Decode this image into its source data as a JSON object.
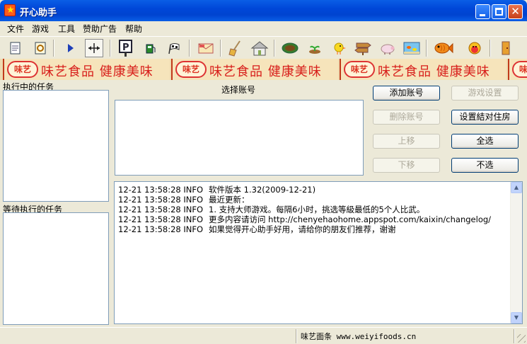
{
  "window": {
    "title": "开心助手",
    "icon": "app-star-icon"
  },
  "menu": [
    "文件",
    "游戏",
    "工具",
    "赞助广告",
    "帮助"
  ],
  "toolbar": {
    "icons": [
      "print-icon",
      "settings-icon",
      "play-icon",
      "resize-arrows-icon",
      "parking-icon",
      "fuel-icon",
      "race-flag-icon",
      "mail-icon",
      "broom-icon",
      "house-icon",
      "garden-icon",
      "sprout-icon",
      "chick-icon",
      "signpost-icon",
      "pig-icon",
      "aquarium-icon",
      "fish-icon",
      "friend-avatar-icon",
      "exit-door-icon"
    ]
  },
  "banner": {
    "logo": "味艺",
    "slogan": "味艺食品 健康美味"
  },
  "running_tasks": {
    "label": "执行中的任务"
  },
  "waiting_tasks": {
    "label": "等待执行的任务"
  },
  "accounts": {
    "label": "选择账号"
  },
  "buttons": {
    "add_account": "添加账号",
    "game_settings": "游戏设置",
    "delete_account": "删除账号",
    "set_house": "设置結对住房",
    "move_up": "上移",
    "select_all": "全选",
    "move_down": "下移",
    "select_none": "不选"
  },
  "log": [
    {
      "time": "12-21 13:58:28 INFO",
      "msg": "软件版本 1.32(2009-12-21)"
    },
    {
      "time": "12-21 13:58:28 INFO",
      "msg": "最近更新："
    },
    {
      "time": "12-21 13:58:28 INFO",
      "msg": "1. 支持大师游戏。每隔6小时，挑选等級最低的5个人比武。"
    },
    {
      "time": "12-21 13:58:28 INFO",
      "msg": "更多内容请访问 http://chenyehaohome.appspot.com/kaixin/changelog/"
    },
    {
      "time": "12-21 13:58:28 INFO",
      "msg": "如果觉得开心助手好用，请给你的朋友们推荐，谢谢"
    }
  ],
  "status": {
    "text": "味艺面条 www.weiyifoods.cn"
  },
  "colors": {
    "title_bar": "#0054e3",
    "banner_text": "#d8201c",
    "window_bg": "#ece9d8"
  }
}
